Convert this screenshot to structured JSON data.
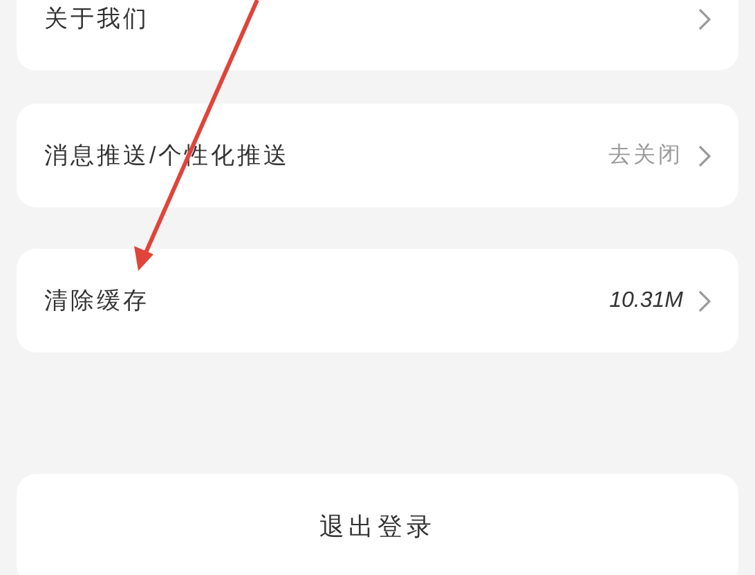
{
  "settings_groups": [
    {
      "items": [
        {
          "label": "关于我们"
        }
      ]
    },
    {
      "items": [
        {
          "label": "消息推送/个性化推送",
          "value": "去关闭",
          "muted": true
        }
      ]
    },
    {
      "items": [
        {
          "label": "清除缓存",
          "value": "10.31M",
          "muted": false
        }
      ]
    }
  ],
  "logout_button": {
    "label": "退出登录"
  }
}
